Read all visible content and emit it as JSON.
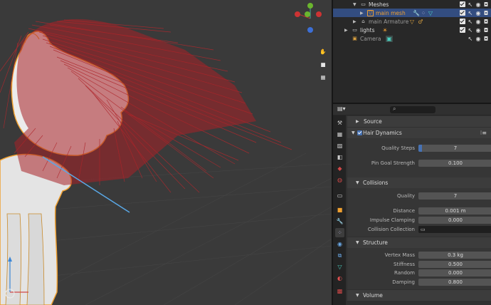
{
  "outliner": {
    "rows": [
      {
        "label": "Meshes"
      },
      {
        "label": "main mesh"
      },
      {
        "label": "main Armature"
      },
      {
        "label": "lights"
      },
      {
        "label": "Camera"
      }
    ]
  },
  "properties": {
    "search_icon": "magnifier-icon",
    "source": {
      "title": "Source"
    },
    "hair_dynamics": {
      "title": "Hair Dynamics",
      "quality_steps": {
        "label": "Quality Steps",
        "value": "7",
        "fraction": 0.05
      },
      "pin_goal": {
        "label": "Pin Goal Strength",
        "value": "0.100"
      }
    },
    "collisions": {
      "title": "Collisions",
      "quality": {
        "label": "Quality",
        "value": "7"
      },
      "distance": {
        "label": "Distance",
        "value": "0.001 m"
      },
      "impulse": {
        "label": "Impulse Clamping",
        "value": "0.000"
      },
      "collection": {
        "label": "Collision Collection",
        "value": ""
      }
    },
    "structure": {
      "title": "Structure",
      "vertex_mass": {
        "label": "Vertex Mass",
        "value": "0.3 kg"
      },
      "stiffness": {
        "label": "Stiffness",
        "value": "0.500"
      },
      "random": {
        "label": "Random",
        "value": "0.000"
      },
      "damping": {
        "label": "Damping",
        "value": "0.800"
      }
    },
    "volume": {
      "title": "Volume"
    }
  },
  "colors": {
    "selection": "#334d80",
    "accent": "#4772b3",
    "hair": "#b3282d",
    "outline": "#f0a030"
  }
}
